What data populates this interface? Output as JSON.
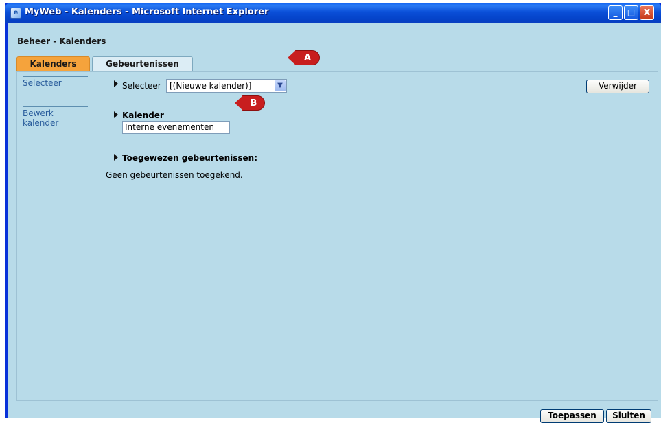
{
  "window": {
    "title": "MyWeb - Kalenders - Microsoft Internet Explorer",
    "icon": "ie-page-icon",
    "controls": {
      "minimize": "_",
      "maximize": "□",
      "close": "X"
    }
  },
  "page": {
    "heading": "Beheer - Kalenders"
  },
  "tabs": [
    {
      "label": "Kalenders",
      "active": true
    },
    {
      "label": "Gebeurtenissen",
      "active": false
    }
  ],
  "sidenav": {
    "items": [
      {
        "label": "Selecteer"
      },
      {
        "label": "Bewerk kalender"
      }
    ]
  },
  "select_row": {
    "label": "Selecteer",
    "selected": "[(Nieuwe kalender)]",
    "dropdown_glyph": "▼"
  },
  "callouts": {
    "a": "A",
    "b": "B"
  },
  "buttons": {
    "verwijder": "Verwijder",
    "toepassen": "Toepassen",
    "sluiten": "Sluiten"
  },
  "kalender": {
    "title": "Kalender",
    "value": "Interne evenementen"
  },
  "assigned": {
    "title": "Toegewezen gebeurtenissen:",
    "empty_text": "Geen gebeurtenissen toegekend."
  },
  "colors": {
    "titlebar": "#0a4fd8",
    "client_bg": "#b8dbe9",
    "active_tab": "#f5a33c",
    "callout": "#c81e1e",
    "link": "#2a5d9c"
  }
}
